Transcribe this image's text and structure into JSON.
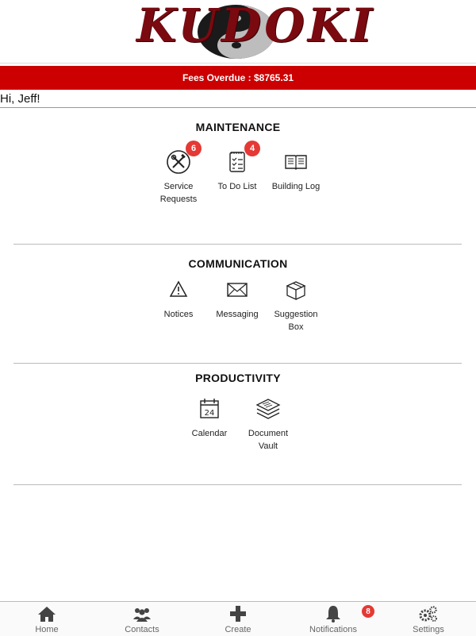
{
  "brand": {
    "logo_text": "KUDOKI",
    "logo_color": "#7a0a10"
  },
  "fees": {
    "label": "Fees Overdue : $8765.31",
    "bar_color": "#cc0000"
  },
  "greeting": "Hi, Jeff!",
  "sections": {
    "maintenance": {
      "title": "MAINTENANCE",
      "tiles": [
        {
          "label": "Service\nRequests",
          "icon": "tools-icon",
          "badge": "6"
        },
        {
          "label": "To Do List",
          "icon": "checklist-icon",
          "badge": "4"
        },
        {
          "label": "Building Log",
          "icon": "book-icon"
        }
      ]
    },
    "communication": {
      "title": "COMMUNICATION",
      "tiles": [
        {
          "label": "Notices",
          "icon": "warning-icon"
        },
        {
          "label": "Messaging",
          "icon": "envelope-icon"
        },
        {
          "label": "Suggestion\nBox",
          "icon": "box-icon"
        }
      ]
    },
    "productivity": {
      "title": "PRODUCTIVITY",
      "tiles": [
        {
          "label": "Calendar",
          "icon": "calendar-icon",
          "calendar_day": "24"
        },
        {
          "label": "Document\nVault",
          "icon": "stacked-documents-icon"
        }
      ]
    }
  },
  "bottom_nav": {
    "items": [
      {
        "label": "Home",
        "icon": "home-icon"
      },
      {
        "label": "Contacts",
        "icon": "contacts-icon"
      },
      {
        "label": "Create",
        "icon": "plus-icon"
      },
      {
        "label": "Notifications",
        "icon": "bell-icon",
        "badge": "8"
      },
      {
        "label": "Settings",
        "icon": "gears-icon"
      }
    ]
  },
  "badge_color": "#e53935"
}
